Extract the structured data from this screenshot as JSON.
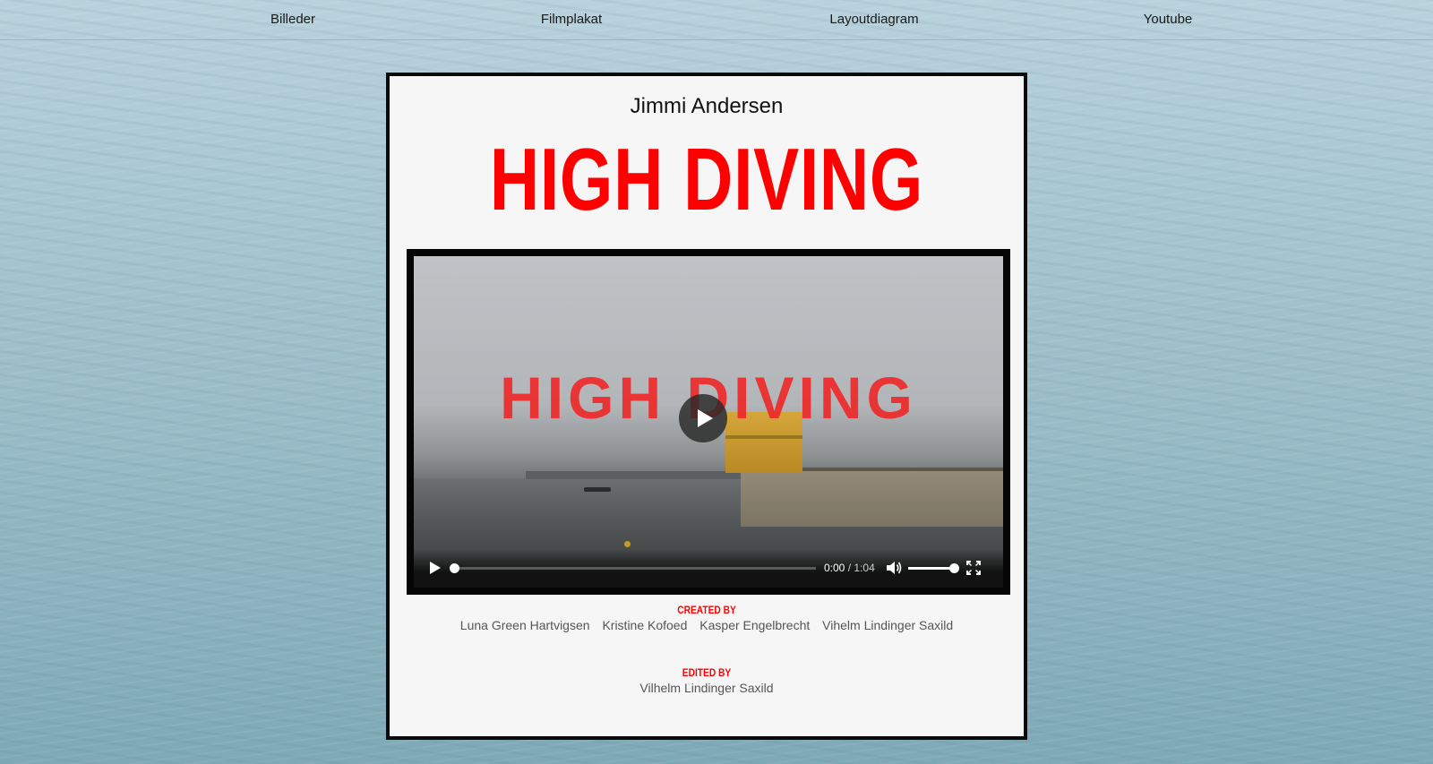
{
  "nav": {
    "items": [
      {
        "label": "Billeder"
      },
      {
        "label": "Filmplakat"
      },
      {
        "label": "Layoutdiagram"
      },
      {
        "label": "Youtube"
      }
    ]
  },
  "poster": {
    "author": "Jimmi Andersen",
    "title": "HIGH DIVING"
  },
  "video": {
    "overlay_title": "HIGH DIVING",
    "current_time": "0:00",
    "separator": "/",
    "duration": "1:04",
    "progress": 0,
    "volume": 1.0,
    "icons": {
      "play": "play-icon",
      "mute": "volume-icon",
      "fullscreen": "fullscreen-icon",
      "big_play": "play-icon"
    }
  },
  "credits": {
    "created_by_label": "CREATED BY",
    "created_by": [
      "Luna Green Hartvigsen",
      "Kristine Kofoed",
      "Kasper Engelbrecht",
      "Vihelm Lindinger Saxild"
    ],
    "edited_by_label": "EDITED BY",
    "edited_by": "Vilhelm Lindinger Saxild"
  },
  "colors": {
    "accent": "#ff0000",
    "frame": "#0a0a0a",
    "poster_bg": "#f6f6f6"
  }
}
